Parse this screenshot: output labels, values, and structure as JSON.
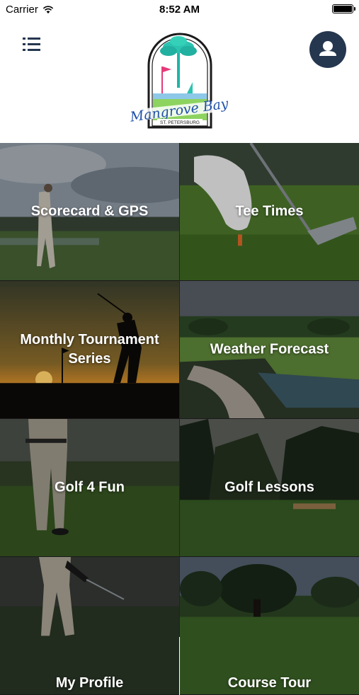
{
  "status_bar": {
    "carrier": "Carrier",
    "time": "8:52 AM",
    "battery_level": 1.0
  },
  "logo": {
    "text": "Mangrove Bay",
    "subtext": "ST. PETERSBURG"
  },
  "tiles": [
    {
      "label": "Scorecard & GPS"
    },
    {
      "label": "Tee Times"
    },
    {
      "label": "Monthly Tournament\nSeries"
    },
    {
      "label": "Weather Forecast"
    },
    {
      "label": "Golf 4 Fun"
    },
    {
      "label": "Golf Lessons"
    },
    {
      "label": "My Profile"
    },
    {
      "label": "Course Tour"
    }
  ],
  "colors": {
    "accent": "#25374f",
    "brand_blue": "#1f4fa8"
  }
}
